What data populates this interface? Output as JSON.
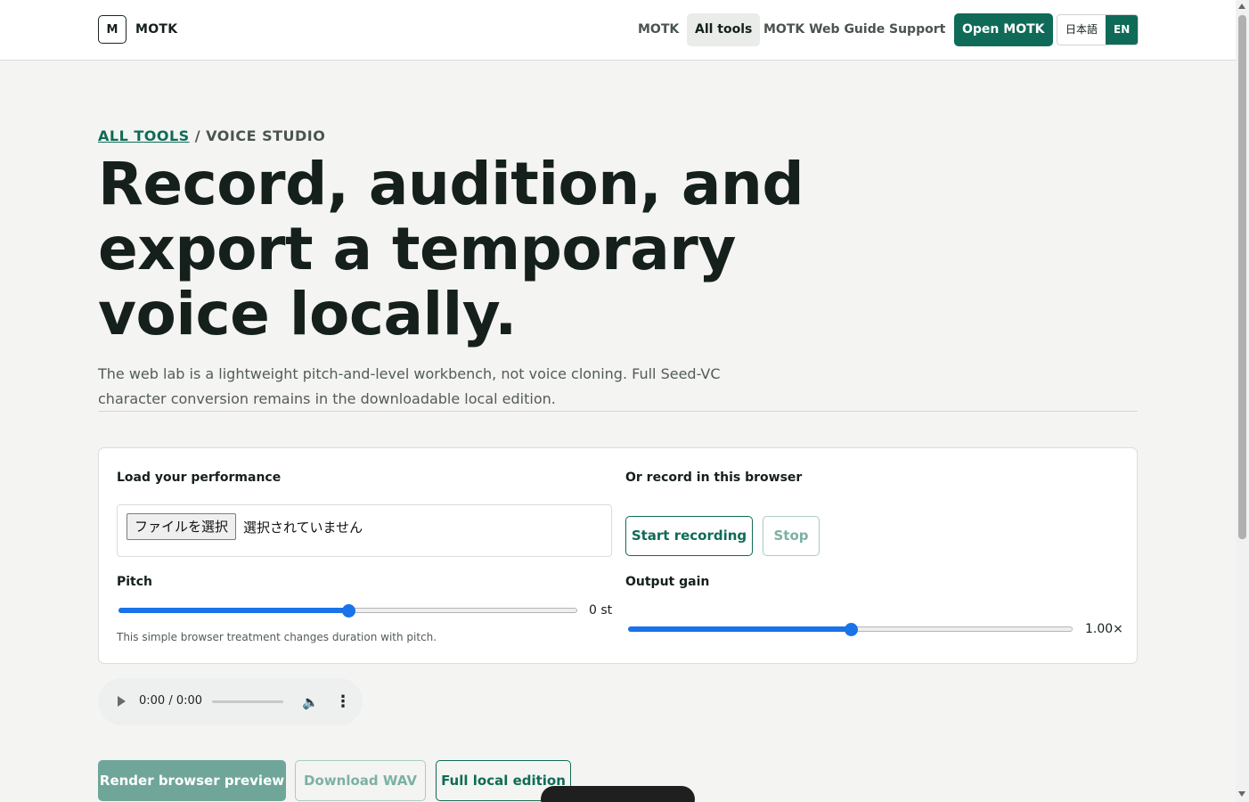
{
  "brand": {
    "mark": "M",
    "name": "MOTK"
  },
  "nav": {
    "items": [
      {
        "label": "MOTK",
        "active": false
      },
      {
        "label": "All tools",
        "active": true
      },
      {
        "label": "MOTK Web Guide",
        "active": false
      },
      {
        "label": "Support",
        "active": false
      }
    ],
    "cta": "Open MOTK",
    "lang": {
      "ja": "日本語",
      "en": "EN",
      "selected": "EN"
    }
  },
  "breadcrumb": {
    "parent": "ALL TOOLS",
    "separator": " / ",
    "current": "VOICE STUDIO"
  },
  "hero": {
    "title": "Record, audition, and export a temporary voice locally.",
    "lead": "The web lab is a lightweight pitch-and-level workbench, not voice cloning. Full Seed-VC character conversion remains in the downloadable local edition."
  },
  "panel": {
    "load_label": "Load your performance",
    "file_button": "ファイルを選択",
    "file_status": "選択されていません",
    "record_label": "Or record in this browser",
    "start_button": "Start recording",
    "stop_button": "Stop",
    "pitch": {
      "label": "Pitch",
      "value": 0,
      "min": -12,
      "max": 12,
      "readout": "0 st",
      "hint": "This simple browser treatment changes duration with pitch."
    },
    "gain": {
      "label": "Output gain",
      "value": 1.0,
      "min": 0,
      "max": 2,
      "readout": "1.00×"
    }
  },
  "player": {
    "time": "0:00 / 0:00"
  },
  "actions": {
    "render": "Render browser preview",
    "download": "Download WAV",
    "full": "Full local edition"
  },
  "colors": {
    "accent": "#0f6b57",
    "slider": "#1a73e8",
    "background": "#f4f4f2"
  }
}
